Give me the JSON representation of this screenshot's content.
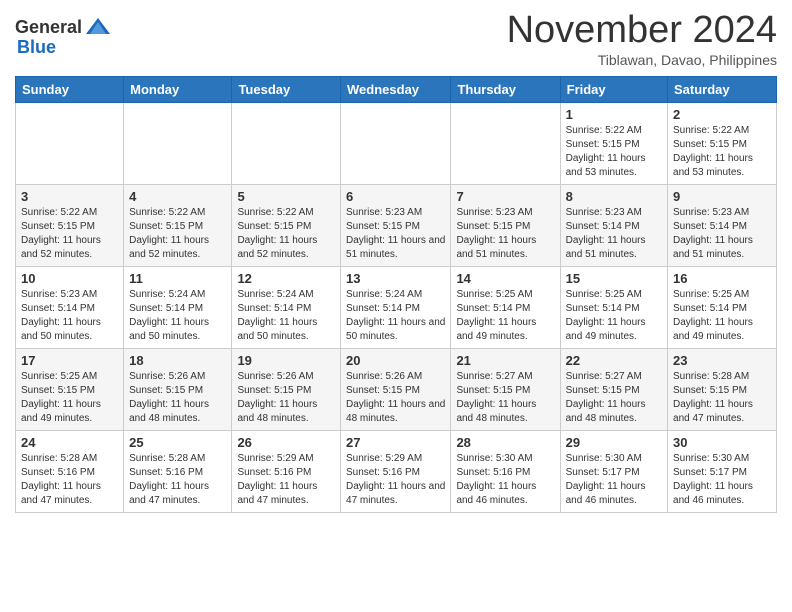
{
  "header": {
    "logo_general": "General",
    "logo_blue": "Blue",
    "month_title": "November 2024",
    "subtitle": "Tiblawan, Davao, Philippines"
  },
  "weekdays": [
    "Sunday",
    "Monday",
    "Tuesday",
    "Wednesday",
    "Thursday",
    "Friday",
    "Saturday"
  ],
  "weeks": [
    [
      {
        "day": "",
        "info": ""
      },
      {
        "day": "",
        "info": ""
      },
      {
        "day": "",
        "info": ""
      },
      {
        "day": "",
        "info": ""
      },
      {
        "day": "",
        "info": ""
      },
      {
        "day": "1",
        "info": "Sunrise: 5:22 AM\nSunset: 5:15 PM\nDaylight: 11 hours and 53 minutes."
      },
      {
        "day": "2",
        "info": "Sunrise: 5:22 AM\nSunset: 5:15 PM\nDaylight: 11 hours and 53 minutes."
      }
    ],
    [
      {
        "day": "3",
        "info": "Sunrise: 5:22 AM\nSunset: 5:15 PM\nDaylight: 11 hours and 52 minutes."
      },
      {
        "day": "4",
        "info": "Sunrise: 5:22 AM\nSunset: 5:15 PM\nDaylight: 11 hours and 52 minutes."
      },
      {
        "day": "5",
        "info": "Sunrise: 5:22 AM\nSunset: 5:15 PM\nDaylight: 11 hours and 52 minutes."
      },
      {
        "day": "6",
        "info": "Sunrise: 5:23 AM\nSunset: 5:15 PM\nDaylight: 11 hours and 51 minutes."
      },
      {
        "day": "7",
        "info": "Sunrise: 5:23 AM\nSunset: 5:15 PM\nDaylight: 11 hours and 51 minutes."
      },
      {
        "day": "8",
        "info": "Sunrise: 5:23 AM\nSunset: 5:14 PM\nDaylight: 11 hours and 51 minutes."
      },
      {
        "day": "9",
        "info": "Sunrise: 5:23 AM\nSunset: 5:14 PM\nDaylight: 11 hours and 51 minutes."
      }
    ],
    [
      {
        "day": "10",
        "info": "Sunrise: 5:23 AM\nSunset: 5:14 PM\nDaylight: 11 hours and 50 minutes."
      },
      {
        "day": "11",
        "info": "Sunrise: 5:24 AM\nSunset: 5:14 PM\nDaylight: 11 hours and 50 minutes."
      },
      {
        "day": "12",
        "info": "Sunrise: 5:24 AM\nSunset: 5:14 PM\nDaylight: 11 hours and 50 minutes."
      },
      {
        "day": "13",
        "info": "Sunrise: 5:24 AM\nSunset: 5:14 PM\nDaylight: 11 hours and 50 minutes."
      },
      {
        "day": "14",
        "info": "Sunrise: 5:25 AM\nSunset: 5:14 PM\nDaylight: 11 hours and 49 minutes."
      },
      {
        "day": "15",
        "info": "Sunrise: 5:25 AM\nSunset: 5:14 PM\nDaylight: 11 hours and 49 minutes."
      },
      {
        "day": "16",
        "info": "Sunrise: 5:25 AM\nSunset: 5:14 PM\nDaylight: 11 hours and 49 minutes."
      }
    ],
    [
      {
        "day": "17",
        "info": "Sunrise: 5:25 AM\nSunset: 5:15 PM\nDaylight: 11 hours and 49 minutes."
      },
      {
        "day": "18",
        "info": "Sunrise: 5:26 AM\nSunset: 5:15 PM\nDaylight: 11 hours and 48 minutes."
      },
      {
        "day": "19",
        "info": "Sunrise: 5:26 AM\nSunset: 5:15 PM\nDaylight: 11 hours and 48 minutes."
      },
      {
        "day": "20",
        "info": "Sunrise: 5:26 AM\nSunset: 5:15 PM\nDaylight: 11 hours and 48 minutes."
      },
      {
        "day": "21",
        "info": "Sunrise: 5:27 AM\nSunset: 5:15 PM\nDaylight: 11 hours and 48 minutes."
      },
      {
        "day": "22",
        "info": "Sunrise: 5:27 AM\nSunset: 5:15 PM\nDaylight: 11 hours and 48 minutes."
      },
      {
        "day": "23",
        "info": "Sunrise: 5:28 AM\nSunset: 5:15 PM\nDaylight: 11 hours and 47 minutes."
      }
    ],
    [
      {
        "day": "24",
        "info": "Sunrise: 5:28 AM\nSunset: 5:16 PM\nDaylight: 11 hours and 47 minutes."
      },
      {
        "day": "25",
        "info": "Sunrise: 5:28 AM\nSunset: 5:16 PM\nDaylight: 11 hours and 47 minutes."
      },
      {
        "day": "26",
        "info": "Sunrise: 5:29 AM\nSunset: 5:16 PM\nDaylight: 11 hours and 47 minutes."
      },
      {
        "day": "27",
        "info": "Sunrise: 5:29 AM\nSunset: 5:16 PM\nDaylight: 11 hours and 47 minutes."
      },
      {
        "day": "28",
        "info": "Sunrise: 5:30 AM\nSunset: 5:16 PM\nDaylight: 11 hours and 46 minutes."
      },
      {
        "day": "29",
        "info": "Sunrise: 5:30 AM\nSunset: 5:17 PM\nDaylight: 11 hours and 46 minutes."
      },
      {
        "day": "30",
        "info": "Sunrise: 5:30 AM\nSunset: 5:17 PM\nDaylight: 11 hours and 46 minutes."
      }
    ]
  ]
}
